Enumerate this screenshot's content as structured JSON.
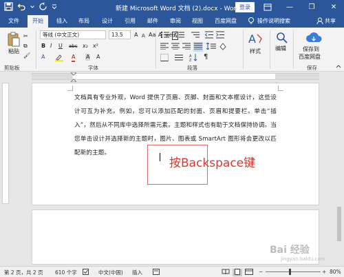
{
  "titlebar": {
    "title": "新建 Microsoft Word 文档 (2).docx - Word",
    "login": "登录",
    "minimize": "—",
    "restore": "❐",
    "close": "✕"
  },
  "tabs": [
    "文件",
    "开始",
    "插入",
    "布局",
    "设计",
    "引用",
    "邮件",
    "审阅",
    "视图",
    "百度网盘"
  ],
  "tell_me": "操作说明搜索",
  "share": "共享",
  "ribbon": {
    "paste": "粘贴",
    "clipboard": "剪贴板",
    "font_name": "等线 (中文正文)",
    "font_size": "13.5",
    "font_group": "字体",
    "paragraph_group": "段落",
    "styles": "样式",
    "editing": "编辑",
    "save_to": "保存到",
    "baidu": "百度网盘",
    "save_group": "保存",
    "font_row1": [
      "A",
      "A",
      "Aa",
      "A",
      "wén",
      "A"
    ],
    "font_row2": [
      "B",
      "I",
      "U",
      "abc",
      "x₂",
      "x²"
    ],
    "font_row3": [
      "A",
      "A",
      "A",
      "A"
    ]
  },
  "document": {
    "paragraph": "文档具有专业外观，Word 提供了页眉、页脚、封面和文本框设计，这些设计可互为补充。例如，您可以添加匹配的封面、页眉和提要栏。单击“插入”，然后从不同库中选择所需元素。主题和样式也有助于文档保持协调。当您单击设计并选择新的主题时，图片、图表或 SmartArt 图形将会更改以匹配新的主题。",
    "annotation": "按Backspace键"
  },
  "status": {
    "page": "第 2 页，共 2 页",
    "words": "610 个字",
    "lang": "中文(中国)",
    "insert": "插入",
    "zoom": "80%"
  },
  "watermark": "Bai 经验",
  "watermark_sub": "jingyan.baidu.com",
  "colors": {
    "accent": "#2b579a",
    "annotation": "#e0352b"
  }
}
